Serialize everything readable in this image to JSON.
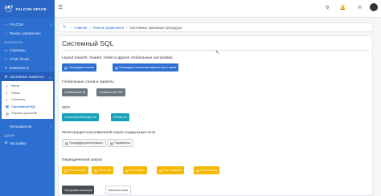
{
  "brand": {
    "name": "FALCON SPACE",
    "logo_icon": "falcon-logo-icon"
  },
  "sidebar": {
    "items_top": [
      {
        "label": "FALCON",
        "icon": "square-icon"
      },
      {
        "label": "Панель управления",
        "icon": "speedometer-icon"
      }
    ],
    "section_label": "РАЗРАБОТКА",
    "items_dev": [
      {
        "label": "Страницы",
        "icon": "page-icon"
      },
      {
        "label": "HTML-блоки",
        "icon": "code-icon"
      },
      {
        "label": "Компоненты",
        "icon": "puzzle-icon"
      },
      {
        "label": "Системные элементы",
        "icon": "gear-icon"
      }
    ],
    "submenu": [
      {
        "label": "Меню",
        "icon": "list-icon"
      },
      {
        "label": "Языки",
        "icon": "list-icon"
      },
      {
        "label": "Сниппеты",
        "icon": "list-icon"
      },
      {
        "label": "Системный SQL",
        "icon": "doc-icon"
      },
      {
        "label": "Перенос решений",
        "icon": "doc-icon"
      }
    ],
    "items_bottom": [
      {
        "label": "Пользователи",
        "icon": "user-icon"
      }
    ],
    "section_label_2": "АДМИН",
    "items_admin": [
      {
        "label": "Настройки",
        "icon": "gear-icon"
      }
    ]
  },
  "breadcrumb": {
    "items": [
      "Главная",
      "Панель управления",
      "Системные хранимые процедуры"
    ]
  },
  "page": {
    "title": "Системный SQL"
  },
  "sections": {
    "layout": {
      "label": "Layout (search, header, footer и другие глобальные настройки)",
      "buttons": [
        "Процедура поиска",
        "Процедура получения данных для Layout"
      ]
    },
    "global": {
      "label": "Глобальные стили и скрипты",
      "buttons": [
        "Глобальный JS",
        "Глобальный CSS"
      ]
    },
    "seo": {
      "label": "SEO",
      "buttons": [
        "Статичный Sitemap.xml",
        "Robots.txt"
      ]
    },
    "registration": {
      "label": "Регистрация пользователей через социальные сети",
      "buttons": [
        "Процедура регистрации",
        "Параметры"
      ]
    },
    "periodic": {
      "label": "Периодический запуск",
      "buttons": [
        "Раз в минуту",
        "Раз в час",
        "Раз в день",
        "Раз в неделю",
        "Раз в месяц"
      ]
    },
    "footer_buttons": [
      "Настройки каталога",
      "Каталоги Lists"
    ]
  },
  "colors": {
    "primary": "#2c6fd1",
    "gray": "#6c757d",
    "teal": "#17a2b8",
    "yellow": "#f5b800"
  }
}
